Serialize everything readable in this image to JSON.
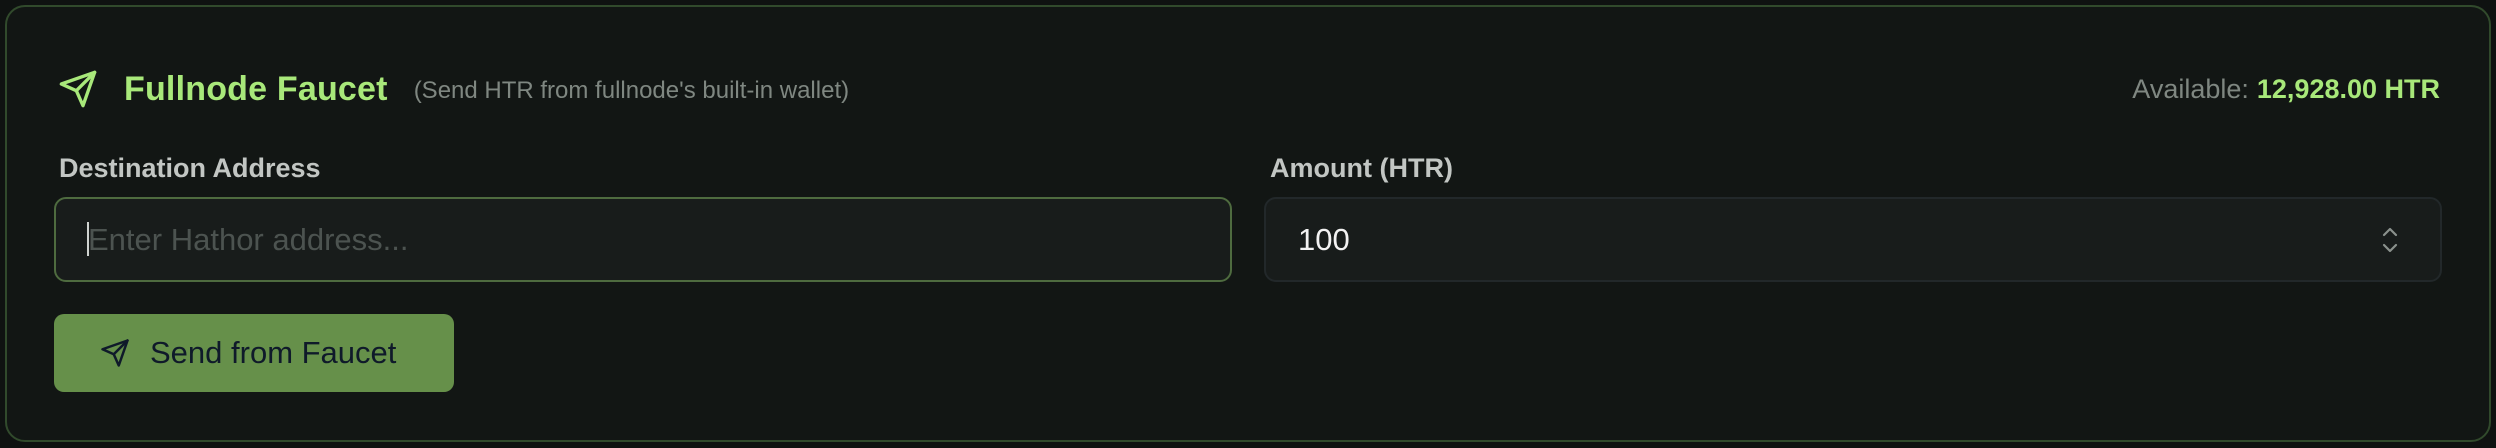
{
  "faucet": {
    "title": "Fullnode Faucet",
    "subtitle": "(Send HTR from fullnode's built-in wallet)",
    "available_label": "Available:",
    "available_value": "12,928.00 HTR",
    "icon": "send-icon"
  },
  "form": {
    "destination_label": "Destination Address",
    "destination_placeholder": "Enter Hathor address...",
    "destination_value": "",
    "amount_label": "Amount (HTR)",
    "amount_value": "100"
  },
  "actions": {
    "send_label": "Send from Faucet",
    "send_icon": "send-icon"
  },
  "colors": {
    "accent": "#a8e87a",
    "button": "#66904a",
    "border": "#314a2c"
  }
}
